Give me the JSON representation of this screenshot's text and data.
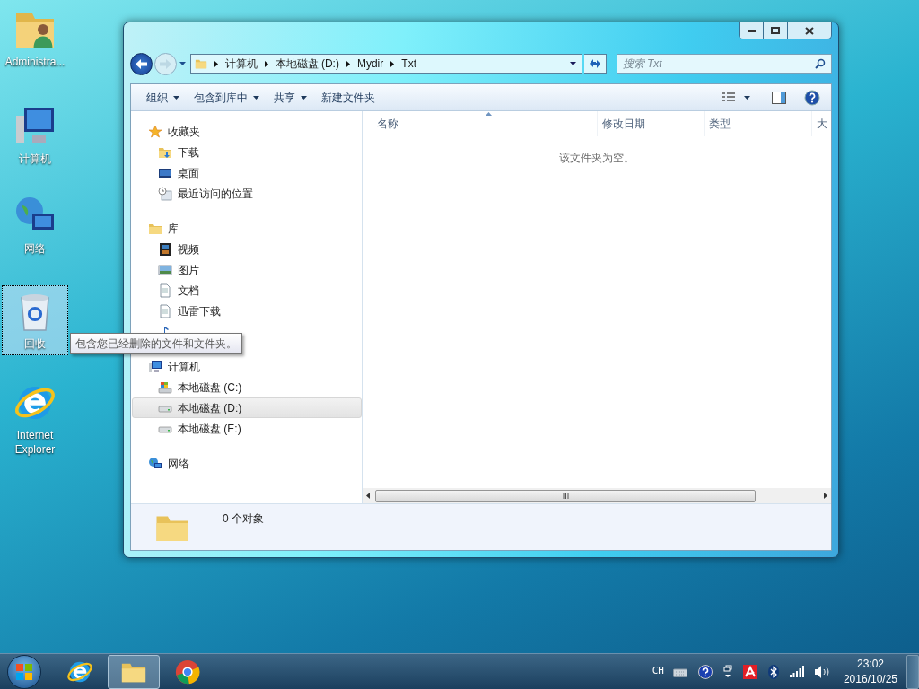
{
  "desktop_icons": [
    {
      "label": "Administra...",
      "kind": "user-folder",
      "selected": false
    },
    {
      "label": "计算机",
      "kind": "computer",
      "selected": false
    },
    {
      "label": "网络",
      "kind": "network",
      "selected": false
    },
    {
      "label": "回收",
      "kind": "recycle-bin",
      "selected": true
    },
    {
      "label": "Internet Explorer",
      "kind": "ie",
      "selected": false
    }
  ],
  "tooltip": "包含您已经删除的文件和文件夹。",
  "window": {
    "breadcrumb": [
      "计算机",
      "本地磁盘 (D:)",
      "Mydir",
      "Txt"
    ],
    "search": {
      "placeholder": "搜索 Txt"
    },
    "toolbar": [
      {
        "label": "组织",
        "dropdown": true
      },
      {
        "label": "包含到库中",
        "dropdown": true
      },
      {
        "label": "共享",
        "dropdown": true
      },
      {
        "label": "新建文件夹",
        "dropdown": false
      }
    ],
    "nav": [
      {
        "label": "收藏夹",
        "kind": "star",
        "selected": false,
        "children": [
          {
            "label": "下载",
            "kind": "download-folder",
            "selected": false
          },
          {
            "label": "桌面",
            "kind": "desktop",
            "selected": false
          },
          {
            "label": "最近访问的位置",
            "kind": "recent",
            "selected": false
          }
        ]
      },
      {
        "label": "库",
        "kind": "library",
        "selected": false,
        "children": [
          {
            "label": "视频",
            "kind": "video",
            "selected": false
          },
          {
            "label": "图片",
            "kind": "picture",
            "selected": false
          },
          {
            "label": "文档",
            "kind": "document",
            "selected": false
          },
          {
            "label": "迅雷下载",
            "kind": "document",
            "selected": false
          },
          {
            "kind": "music",
            "selected": false
          }
        ]
      },
      {
        "label": "计算机",
        "kind": "computer",
        "selected": false,
        "children": [
          {
            "label": "本地磁盘 (C:)",
            "kind": "drive-system",
            "selected": false
          },
          {
            "label": "本地磁盘 (D:)",
            "kind": "drive",
            "selected": true
          },
          {
            "label": "本地磁盘 (E:)",
            "kind": "drive",
            "selected": false
          }
        ]
      },
      {
        "label": "网络",
        "kind": "network",
        "selected": false
      }
    ],
    "columns": [
      "名称",
      "修改日期",
      "类型",
      "大"
    ],
    "empty_message": "该文件夹为空。",
    "status": "0 个对象"
  },
  "taskbar": {
    "apps": [
      {
        "kind": "ie",
        "active": false
      },
      {
        "kind": "explorer",
        "active": true
      },
      {
        "kind": "chrome",
        "active": false
      }
    ],
    "language": "CH",
    "time": "23:02",
    "date": "2016/10/25"
  }
}
